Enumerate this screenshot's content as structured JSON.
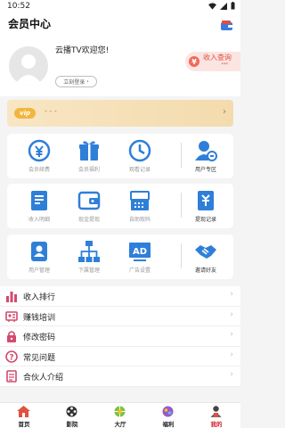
{
  "status": {
    "time": "10:52"
  },
  "header": {
    "title": "会员中心"
  },
  "profile": {
    "welcome": "云播TV欢迎您!",
    "login_label": "立刻登录",
    "income_query_label": "收入查询",
    "income_query_dots": "***"
  },
  "vip": {
    "badge": "vip",
    "text": "- - -"
  },
  "grid": [
    [
      {
        "label": "会员续费",
        "icon": "yen-renew-icon"
      },
      {
        "label": "会员福利",
        "icon": "gift-icon"
      },
      {
        "label": "观看记录",
        "icon": "clock-icon"
      },
      {
        "label": "用户专区",
        "icon": "user-zone-icon"
      }
    ],
    [
      {
        "label": "收入明细",
        "icon": "income-detail-icon"
      },
      {
        "label": "现金提现",
        "icon": "wallet-icon"
      },
      {
        "label": "自助取码",
        "icon": "register-icon"
      },
      {
        "label": "提现记录",
        "icon": "withdraw-record-icon"
      }
    ],
    [
      {
        "label": "用户管理",
        "icon": "user-manage-icon"
      },
      {
        "label": "下属管理",
        "icon": "hierarchy-icon"
      },
      {
        "label": "广告设置",
        "icon": "ad-icon",
        "icon_text": "AD"
      },
      {
        "label": "邀请好友",
        "icon": "handshake-icon"
      }
    ]
  ],
  "menu": [
    {
      "label": "收入排行",
      "icon": "rank-icon"
    },
    {
      "label": "赚钱培训",
      "icon": "training-icon"
    },
    {
      "label": "修改密码",
      "icon": "lock-icon"
    },
    {
      "label": "常见问题",
      "icon": "question-icon"
    },
    {
      "label": "合伙人介绍",
      "icon": "partner-icon"
    }
  ],
  "tabs": [
    {
      "label": "首页",
      "icon": "home-icon"
    },
    {
      "label": "影院",
      "icon": "film-reel-icon"
    },
    {
      "label": "大厅",
      "icon": "hall-icon"
    },
    {
      "label": "福利",
      "icon": "welfare-icon"
    },
    {
      "label": "我的",
      "icon": "person-icon",
      "active": true
    }
  ],
  "colors": {
    "accent_blue": "#2f7fd8",
    "active_red": "#d0222c",
    "vip_gold": "#f3dbad"
  }
}
